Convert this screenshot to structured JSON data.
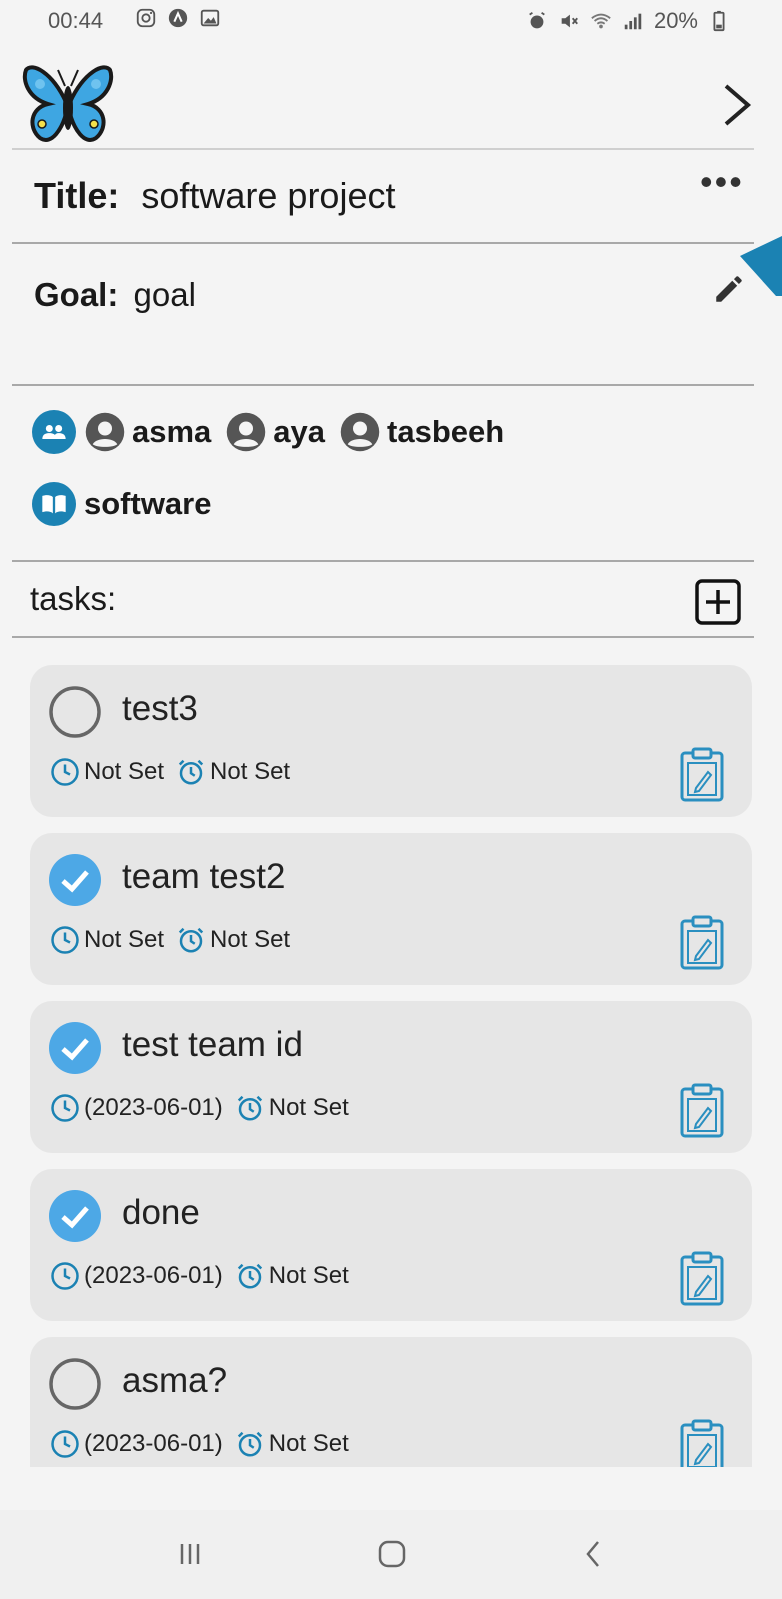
{
  "status_bar": {
    "time": "00:44",
    "left_icons": [
      "instagram-icon",
      "app-icon",
      "gallery-icon"
    ],
    "right_icons": [
      "alarm-icon",
      "mute-icon",
      "wifi-icon",
      "signal-icon",
      "battery-icon"
    ],
    "battery": "20%"
  },
  "header": {
    "logo": "butterfly-logo",
    "next_icon": "chevron-right-icon"
  },
  "project": {
    "title_label": "Title:",
    "title_value": "software project",
    "more_label": "•••",
    "goal_label": "Goal:",
    "goal_value": "goal"
  },
  "members": {
    "group_icon": "group-icon",
    "items": [
      {
        "name": "asma"
      },
      {
        "name": "aya"
      },
      {
        "name": "tasbeeh"
      }
    ]
  },
  "subject": {
    "icon": "book-icon",
    "name": "software"
  },
  "tasks": {
    "label": "tasks:",
    "add_icon": "add-box-icon",
    "items": [
      {
        "title": "test3",
        "done": false,
        "date": "Not Set",
        "alarm": "Not Set"
      },
      {
        "title": "team test2",
        "done": true,
        "date": "Not Set",
        "alarm": "Not Set"
      },
      {
        "title": "test team id",
        "done": true,
        "date": "(2023-06-01)",
        "alarm": "Not Set"
      },
      {
        "title": "done",
        "done": true,
        "date": "(2023-06-01)",
        "alarm": "Not Set"
      },
      {
        "title": "asma?",
        "done": false,
        "date": "(2023-06-01)",
        "alarm": "Not Set"
      }
    ]
  },
  "colors": {
    "accent": "#1b82b3",
    "check_blue": "#4da8e6",
    "card_bg": "#e6e6e6",
    "page_bg": "#f4f4f4"
  },
  "nav": {
    "recent_icon": "recent-apps-icon",
    "home_icon": "home-icon",
    "back_icon": "back-icon"
  }
}
